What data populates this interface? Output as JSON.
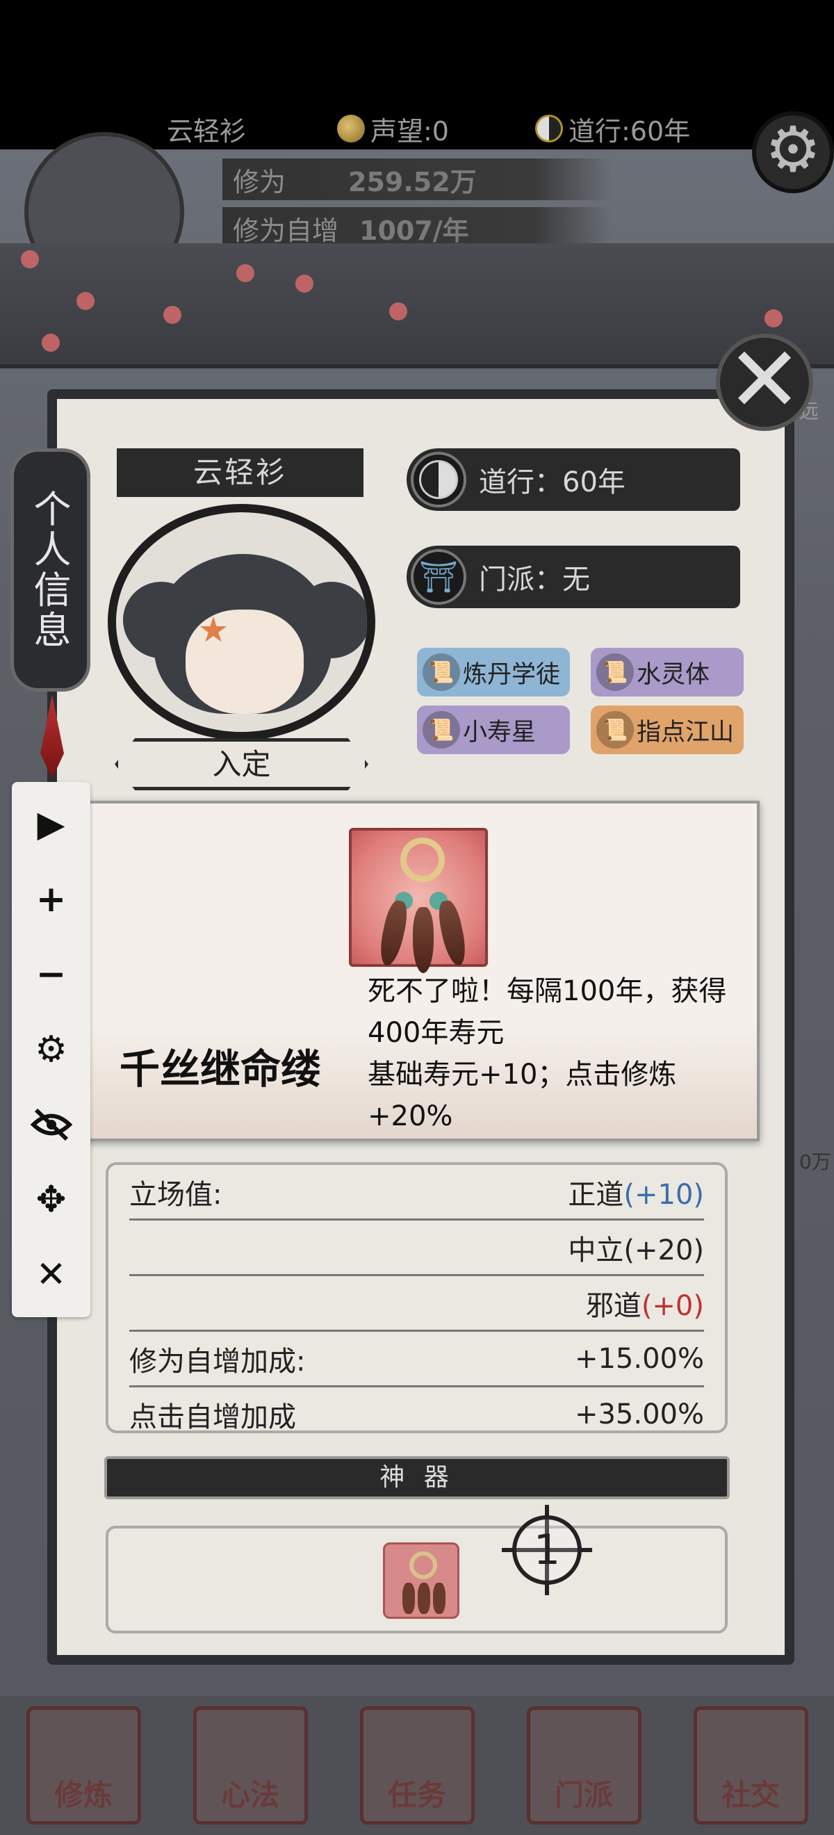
{
  "hud": {
    "player_name": "云轻衫",
    "reputation": "声望:0",
    "daoxing": "道行:60年",
    "cultivation_label": "修为",
    "cultivation_value": "259.52万",
    "auto_label": "修为自增",
    "auto_value": "1007/年",
    "right_edge_hint": "远",
    "right_edge_value": "0万"
  },
  "side_tab": {
    "label": "个人信息"
  },
  "profile": {
    "name": "云轻衫",
    "state_button": "入定",
    "daoxing": "道行：60年",
    "sect": "门派：无",
    "tags": [
      "炼丹学徒",
      "水灵体",
      "小寿星",
      "指点江山"
    ]
  },
  "popup": {
    "title": "千丝继命缕",
    "description_line1": "死不了啦！每隔100年，获得400年寿元",
    "description_line2": "基础寿元+10；点击修炼+20%"
  },
  "stats": {
    "stance_label": "立场值:",
    "righteous": "正道",
    "righteous_value": "(+10)",
    "neutral": "中立(+20)",
    "evil": "邪道",
    "evil_value": "(+0)",
    "auto_bonus_label": "修为自增加成:",
    "auto_bonus_value": "+15.00%",
    "click_bonus_label": "点击自增加成",
    "click_bonus_value": "+35.00%"
  },
  "artifact": {
    "header": "神 器",
    "slot_count": "1"
  },
  "bottom_nav": [
    "修炼",
    "心法",
    "任务",
    "门派",
    "社交"
  ],
  "toolstrip": [
    "play-icon",
    "plus-icon",
    "minus-icon",
    "gear-icon",
    "eye-off-icon",
    "move-icon",
    "close-icon"
  ],
  "colors": {
    "righteous": "#3a6ea8",
    "evil": "#c03030",
    "panel": "#e9e6e0"
  }
}
